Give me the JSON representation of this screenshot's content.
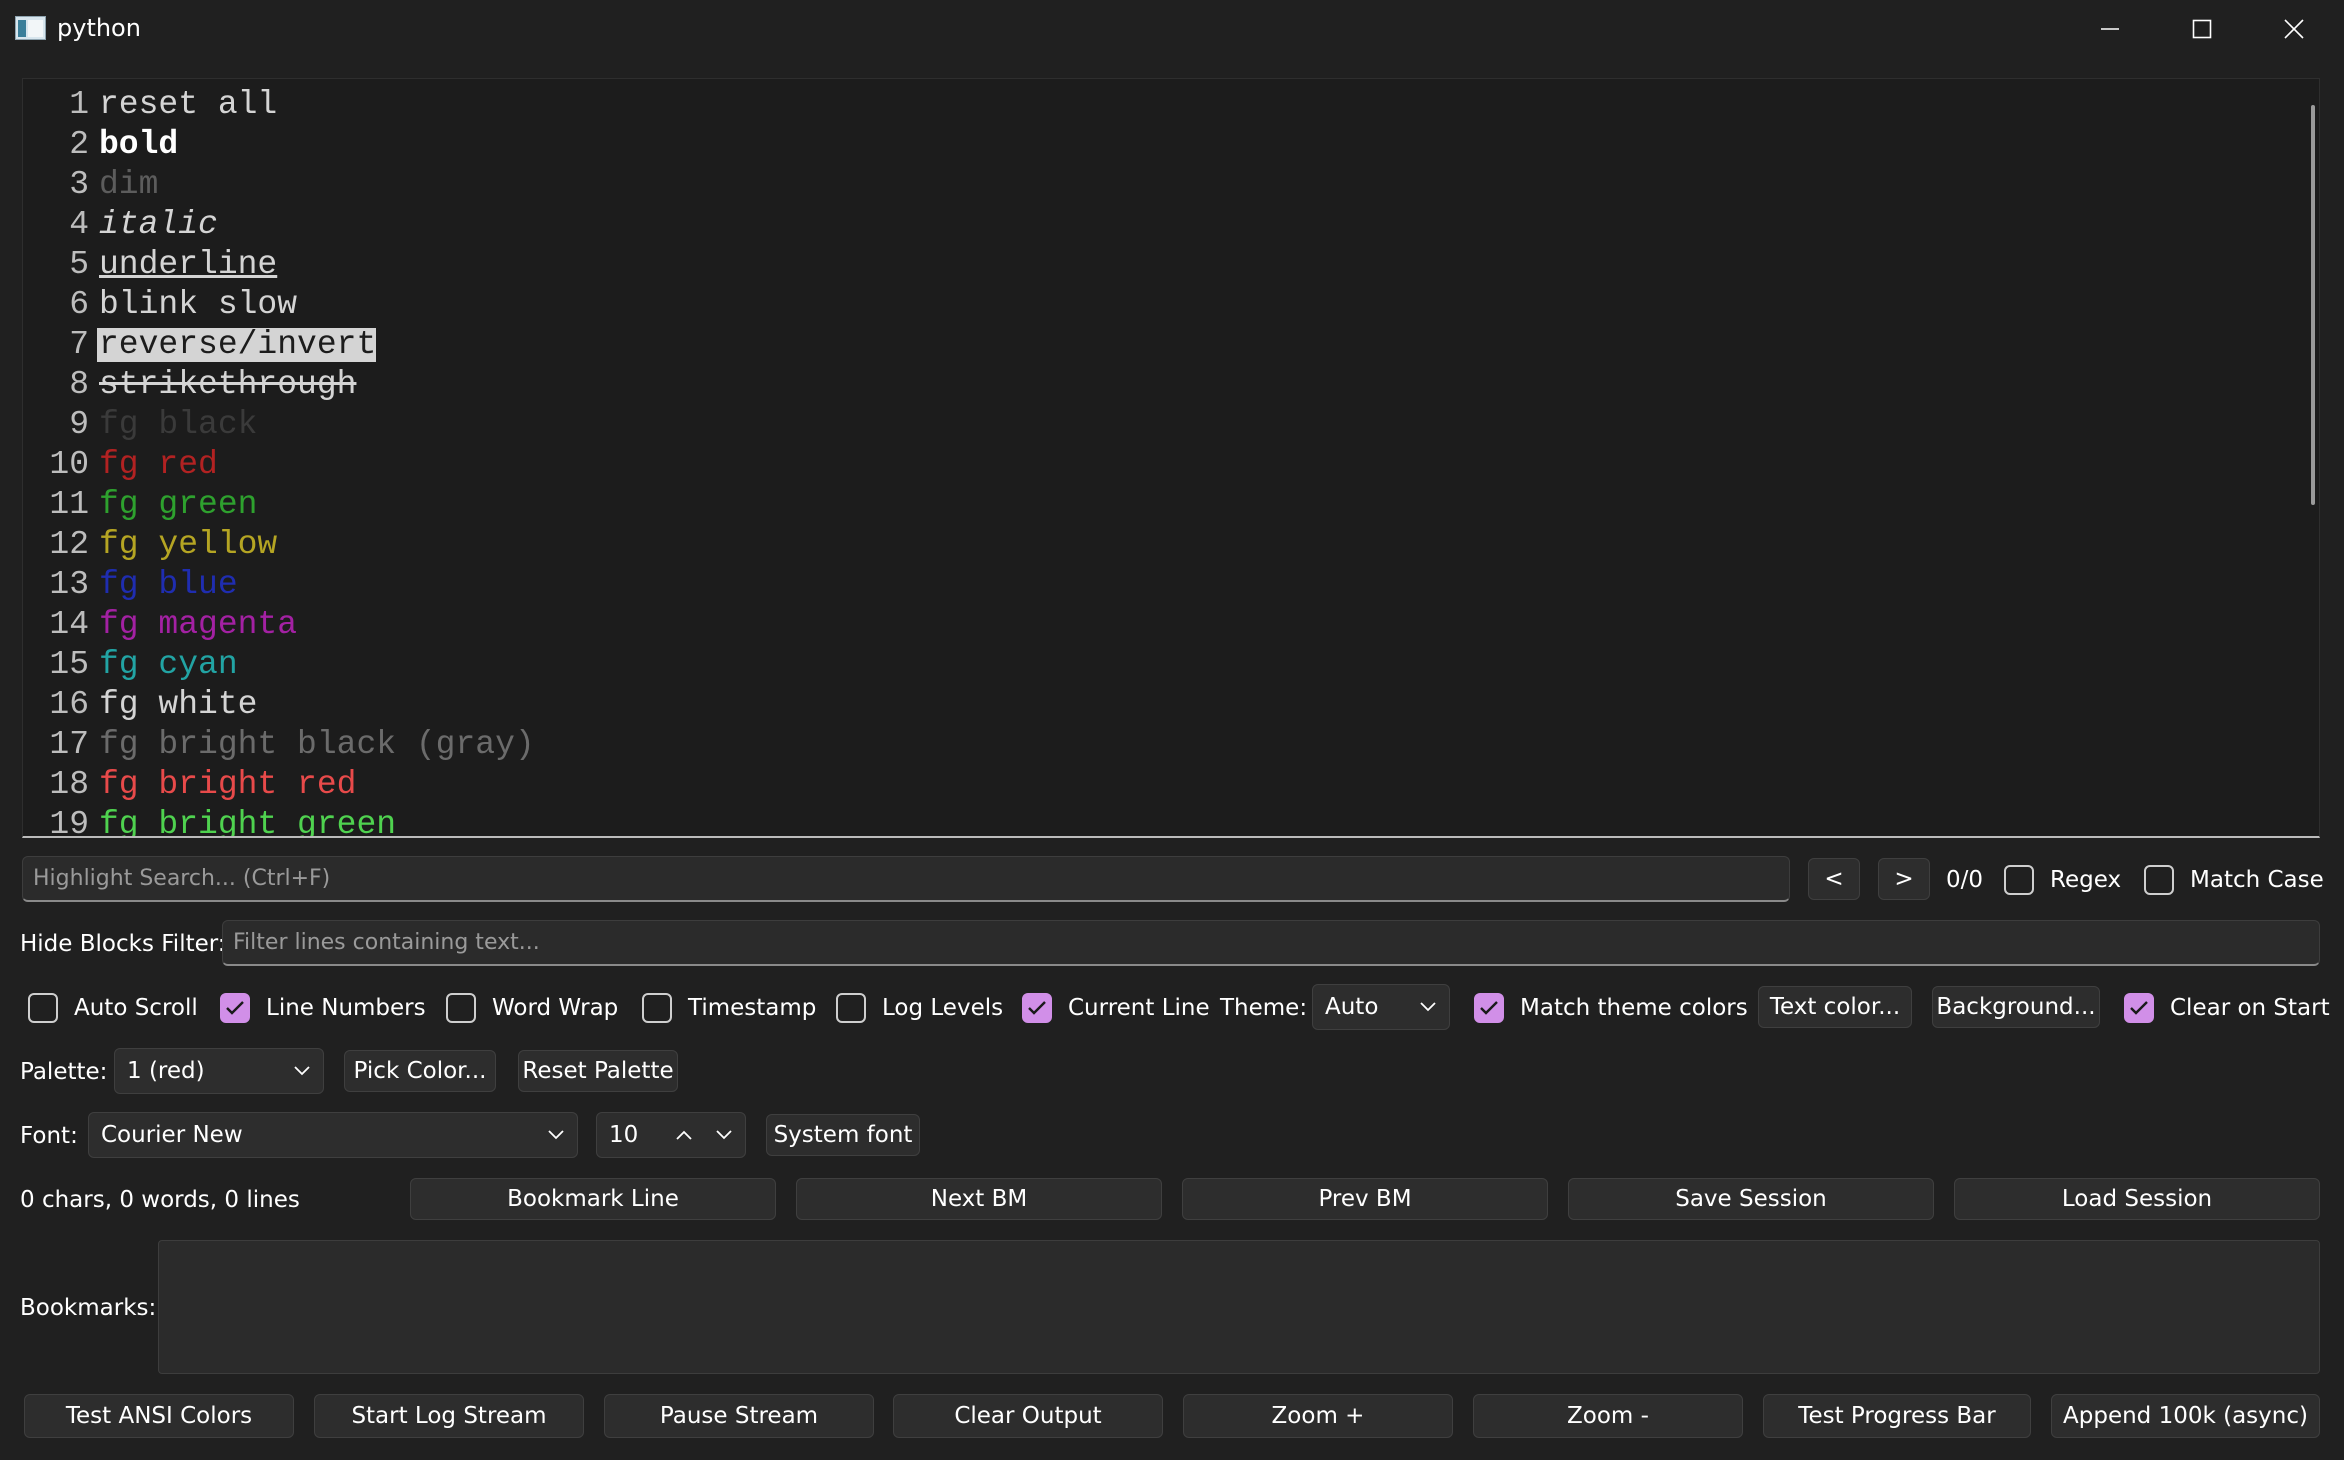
{
  "window": {
    "title": "python"
  },
  "editor": {
    "lines": [
      {
        "n": "1",
        "text": "reset all",
        "color": "#d4d4d4",
        "style": ""
      },
      {
        "n": "2",
        "text": "bold",
        "color": "#ffffff",
        "style": "bold"
      },
      {
        "n": "3",
        "text": "dim",
        "color": "#5c5c5c",
        "style": ""
      },
      {
        "n": "4",
        "text": "italic",
        "color": "#d4d4d4",
        "style": "italic"
      },
      {
        "n": "5",
        "text": "underline",
        "color": "#d4d4d4",
        "style": "underline"
      },
      {
        "n": "6",
        "text": "blink slow",
        "color": "#d4d4d4",
        "style": ""
      },
      {
        "n": "7",
        "text": "reverse/invert",
        "color": "#1c1c1c",
        "style": "reverse"
      },
      {
        "n": "8",
        "text": "strikethrough",
        "color": "#d4d4d4",
        "style": "strike"
      },
      {
        "n": "9",
        "text": "fg black",
        "color": "#3a3a3a",
        "style": ""
      },
      {
        "n": "10",
        "text": "fg red",
        "color": "#b22222",
        "style": ""
      },
      {
        "n": "11",
        "text": "fg green",
        "color": "#2ea12e",
        "style": ""
      },
      {
        "n": "12",
        "text": "fg yellow",
        "color": "#b5a523",
        "style": ""
      },
      {
        "n": "13",
        "text": "fg blue",
        "color": "#1f2db0",
        "style": ""
      },
      {
        "n": "14",
        "text": "fg magenta",
        "color": "#a321a3",
        "style": ""
      },
      {
        "n": "15",
        "text": "fg cyan",
        "color": "#22a4a4",
        "style": ""
      },
      {
        "n": "16",
        "text": "fg white",
        "color": "#d4d4d4",
        "style": ""
      },
      {
        "n": "17",
        "text": "fg bright black (gray)",
        "color": "#6b6b6b",
        "style": ""
      },
      {
        "n": "18",
        "text": "fg bright red",
        "color": "#e84a4a",
        "style": ""
      },
      {
        "n": "19",
        "text": "fg bright green",
        "color": "#4fd24f",
        "style": ""
      }
    ]
  },
  "search": {
    "placeholder": "Highlight Search... (Ctrl+F)",
    "prev_label": "<",
    "next_label": ">",
    "count": "0/0",
    "regex_label": "Regex",
    "regex_checked": false,
    "match_case_label": "Match Case",
    "match_case_checked": false
  },
  "filter": {
    "label": "Hide Blocks Filter:",
    "placeholder": "Filter lines containing text..."
  },
  "options": {
    "auto_scroll": {
      "label": "Auto Scroll",
      "checked": false
    },
    "line_numbers": {
      "label": "Line Numbers",
      "checked": true
    },
    "word_wrap": {
      "label": "Word Wrap",
      "checked": false
    },
    "timestamp": {
      "label": "Timestamp",
      "checked": false
    },
    "log_levels": {
      "label": "Log Levels",
      "checked": false
    },
    "current_line": {
      "label": "Current Line",
      "checked": true
    },
    "theme_label": "Theme:",
    "theme_value": "Auto",
    "match_theme": {
      "label": "Match theme colors",
      "checked": true
    },
    "text_color_label": "Text color...",
    "background_label": "Background...",
    "clear_on_start": {
      "label": "Clear on Start",
      "checked": true
    }
  },
  "palette": {
    "label": "Palette:",
    "value": "1 (red)",
    "pick_label": "Pick Color...",
    "reset_label": "Reset Palette"
  },
  "font": {
    "label": "Font:",
    "family": "Courier New",
    "size": "10",
    "system_label": "System font"
  },
  "stats": {
    "text": "0 chars, 0 words, 0 lines"
  },
  "bookmark_buttons": {
    "bookmark_line": "Bookmark Line",
    "next_bm": "Next BM",
    "prev_bm": "Prev BM",
    "save_session": "Save Session",
    "load_session": "Load Session"
  },
  "bookmarks": {
    "label": "Bookmarks:"
  },
  "bottom_buttons": {
    "test_ansi": "Test ANSI Colors",
    "start_log": "Start Log Stream",
    "pause": "Pause Stream",
    "clear": "Clear Output",
    "zoom_in": "Zoom +",
    "zoom_out": "Zoom -",
    "test_progress": "Test Progress Bar",
    "append": "Append 100k (async)"
  },
  "colors": {
    "accent": "#d18fe8",
    "background": "#202020",
    "editor_bg": "#1c1c1c"
  }
}
